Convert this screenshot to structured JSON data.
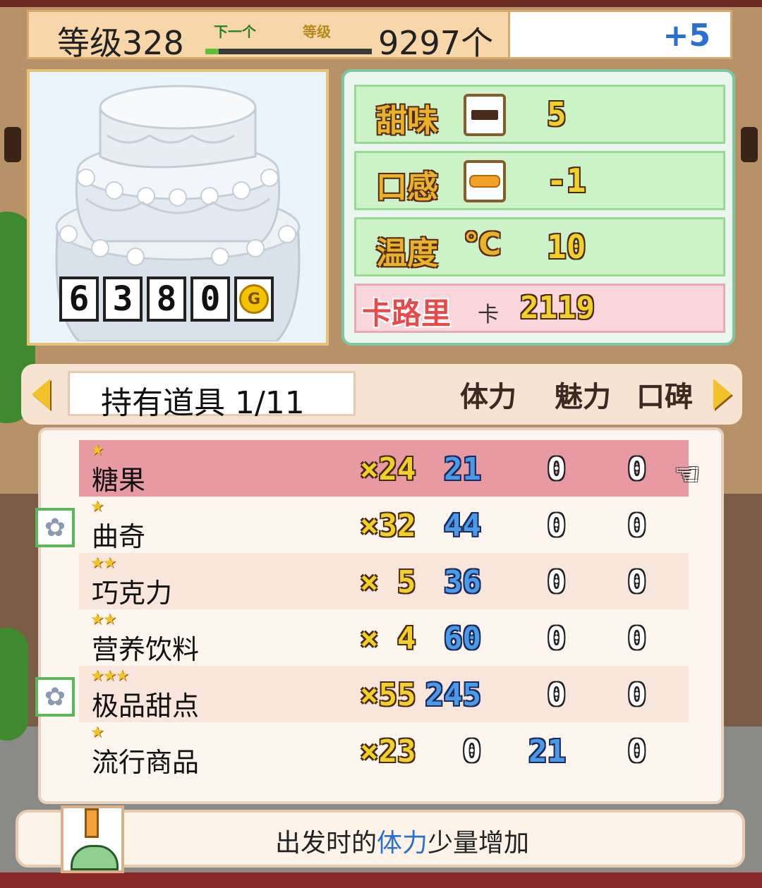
{
  "header": {
    "level": "等级328",
    "next_label": "下一个",
    "grade_label": "等级",
    "exp_progress": 0.08,
    "count": "9297个",
    "plus": "+5"
  },
  "cake": {
    "price_digits": [
      "6",
      "3",
      "8",
      "0"
    ],
    "currency": "G"
  },
  "stats": {
    "sweetness": {
      "label": "甜味",
      "icon": "chocolate-icon",
      "value": "5"
    },
    "texture": {
      "label": "口感",
      "icon": "bread-icon",
      "value": "-1"
    },
    "temperature": {
      "label": "温度",
      "unit": "℃",
      "value": "10"
    },
    "calorie": {
      "label": "卡路里",
      "unit": "卡",
      "value": "2119"
    }
  },
  "items_header": {
    "title": "持有道具 1/11",
    "col_stamina": "体力",
    "col_charm": "魅力",
    "col_reputation": "口碑"
  },
  "items": [
    {
      "stars": "★",
      "name": "糖果",
      "qty": "×24",
      "stamina": "21",
      "charm": "0",
      "reputation": "0",
      "gear": false,
      "selected": true
    },
    {
      "stars": "★",
      "name": "曲奇",
      "qty": "×32",
      "stamina": "44",
      "charm": "0",
      "reputation": "0",
      "gear": true,
      "selected": false
    },
    {
      "stars": "★★",
      "name": "巧克力",
      "qty": "× 5",
      "stamina": "36",
      "charm": "0",
      "reputation": "0",
      "gear": false,
      "selected": false
    },
    {
      "stars": "★★",
      "name": "营养饮料",
      "qty": "× 4",
      "stamina": "60",
      "charm": "0",
      "reputation": "0",
      "gear": false,
      "selected": false
    },
    {
      "stars": "★★★",
      "name": "极品甜点",
      "qty": "×55",
      "stamina": "245",
      "charm": "0",
      "reputation": "0",
      "gear": true,
      "selected": false
    },
    {
      "stars": "★",
      "name": "流行商品",
      "qty": "×23",
      "stamina": "0",
      "charm": "21",
      "reputation": "0",
      "gear": false,
      "selected": false
    }
  ],
  "description": {
    "prefix": "出发时的",
    "highlight": "体力",
    "suffix": "少量增加"
  },
  "colors": {
    "accent_blue": "#2a6fd6",
    "selected_row": "#e89aa2",
    "stat_gold": "#f2d02a"
  }
}
